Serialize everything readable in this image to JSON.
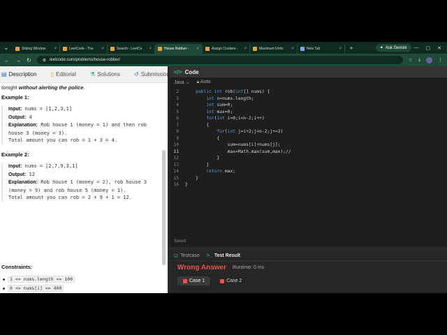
{
  "browser": {
    "tabs": [
      {
        "title": "Sliding Window",
        "active": false
      },
      {
        "title": "LeetCode - The",
        "active": false
      },
      {
        "title": "Search - LeetCo",
        "active": false
      },
      {
        "title": "House Robber -",
        "active": true
      },
      {
        "title": "Assign Cookies -",
        "active": false
      },
      {
        "title": "Maximum Units",
        "active": false
      },
      {
        "title": "New Tab",
        "active": false
      }
    ],
    "ask_gemini": "Ask Gemini",
    "url": "leetcode.com/problems/house-robber/"
  },
  "left": {
    "tabs": {
      "description": "Description",
      "editorial": "Editorial",
      "solutions": "Solutions",
      "submissions": "Submissions"
    },
    "intro_start": "tonight ",
    "intro_em": "without alerting the police",
    "intro_end": ".",
    "example1_title": "Example 1:",
    "example1": {
      "input_label": "Input:",
      "input": " nums = [1,2,3,1]",
      "output_label": "Output:",
      "output": " 4",
      "explanation_label": "Explanation:",
      "explanation": " Rob house 1 (money = 1) and then rob house 3 (money = 3).\nTotal amount you can rob = 1 + 3 = 4."
    },
    "example2_title": "Example 2:",
    "example2": {
      "input_label": "Input:",
      "input": " nums = [2,7,9,3,1]",
      "output_label": "Output:",
      "output": " 12",
      "explanation_label": "Explanation:",
      "explanation": " Rob house 1 (money = 2), rob house 3 (money = 9) and rob house 5 (money = 1).\nTotal amount you can rob = 2 + 9 + 1 = 12."
    },
    "constraints_title": "Constraints:",
    "constraints": [
      "1 <= nums.length <= 100",
      "0 <= nums[i] <= 400"
    ]
  },
  "code": {
    "title": "Code",
    "language": "Java",
    "mode": "Auto",
    "saved": "Saved",
    "lines": [
      {
        "n": "2",
        "t": "    public int rob(int[] nums) {"
      },
      {
        "n": "3",
        "t": "        int n=nums.length;"
      },
      {
        "n": "4",
        "t": "        int sum=0;"
      },
      {
        "n": "5",
        "t": "        int max=0;"
      },
      {
        "n": "6",
        "t": "        for(int i=0;i<n-2;i++)"
      },
      {
        "n": "7",
        "t": "        {"
      },
      {
        "n": "8",
        "t": "            for(int j=i+2;j<n-2;j+=2)"
      },
      {
        "n": "9",
        "t": "            {"
      },
      {
        "n": "10",
        "t": "                sum=nums[i]+nums[j];"
      },
      {
        "n": "11",
        "t": "                max=Math.max(sum,max);//"
      },
      {
        "n": "12",
        "t": "            }"
      },
      {
        "n": "13",
        "t": "        }"
      },
      {
        "n": "14",
        "t": "        return max;"
      },
      {
        "n": "15",
        "t": "    }"
      },
      {
        "n": "16",
        "t": "}"
      }
    ]
  },
  "result": {
    "tabs": {
      "testcase": "Testcase",
      "test_result": "Test Result"
    },
    "status": "Wrong Answer",
    "runtime": "Runtime: 0 ms",
    "cases": [
      "Case 1",
      "Case 2"
    ]
  },
  "colors": {
    "wrong": "#f0504f",
    "accent_green": "#2fbf71"
  }
}
